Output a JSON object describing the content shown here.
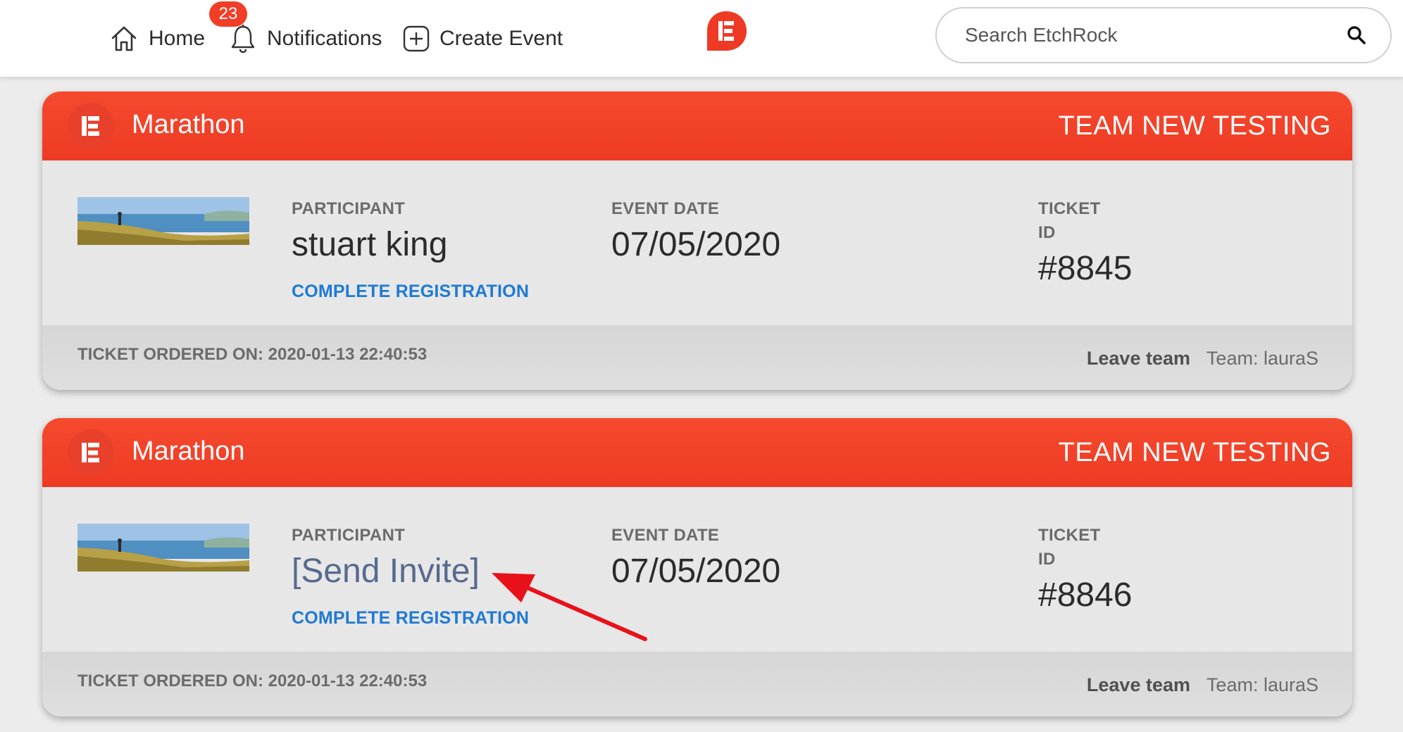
{
  "nav": {
    "home_label": "Home",
    "notifications_label": "Notifications",
    "notifications_count": "23",
    "create_event_label": "Create Event"
  },
  "search": {
    "placeholder": "Search EtchRock"
  },
  "tickets": [
    {
      "event_name": "Marathon",
      "team_name": "TEAM NEW TESTING",
      "participant_label": "PARTICIPANT",
      "participant_value": "stuart king",
      "complete_link": "COMPLETE REGISTRATION",
      "event_date_label": "EVENT DATE",
      "event_date_value": "07/05/2020",
      "ticket_label_1": "TICKET",
      "ticket_label_2": "ID",
      "ticket_id": "#8845",
      "ordered_label": "TICKET ORDERED ON:",
      "ordered_value": "2020-01-13 22:40:53",
      "leave_team_label": "Leave team",
      "team_label": "Team: lauraS"
    },
    {
      "event_name": "Marathon",
      "team_name": "TEAM NEW TESTING",
      "participant_label": "PARTICIPANT",
      "participant_value": "[Send Invite]",
      "complete_link": "COMPLETE REGISTRATION",
      "event_date_label": "EVENT DATE",
      "event_date_value": "07/05/2020",
      "ticket_label_1": "TICKET",
      "ticket_label_2": "ID",
      "ticket_id": "#8846",
      "ordered_label": "TICKET ORDERED ON:",
      "ordered_value": "2020-01-13 22:40:53",
      "leave_team_label": "Leave team",
      "team_label": "Team: lauraS"
    }
  ],
  "icons": {
    "home": "home-icon",
    "notifications": "bell-icon",
    "create_event": "plus-square-icon",
    "brand": "etchrock-logo-icon",
    "search": "search-icon",
    "annotation": "red-arrow-icon"
  },
  "colors": {
    "brand_red": "#ee3a24",
    "badge_red": "#f23d27",
    "link_blue": "#1e7ad3",
    "invite_slate": "#566a8e",
    "arrow_red": "#e8111a"
  }
}
